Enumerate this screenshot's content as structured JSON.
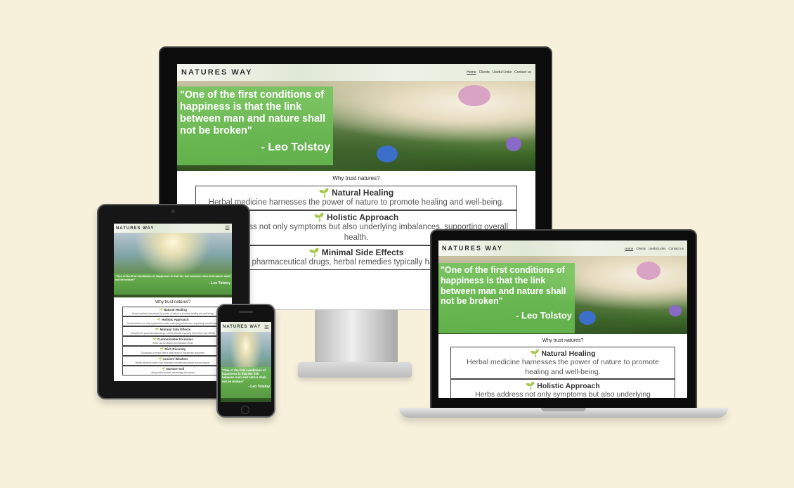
{
  "site": {
    "logo": "NATURES WAY",
    "nav": [
      "Home",
      "Clients",
      "Useful Links",
      "Contact us"
    ]
  },
  "hero": {
    "quote": "\"One of the first conditions of happiness is that the link between man and nature shall not be broken\"",
    "author": "- Leo Tolstoy"
  },
  "why": "Why trust natures?",
  "features": [
    {
      "title": "Natural Healing",
      "text": "Herbal medicine harnesses the power of nature to promote healing and well-being."
    },
    {
      "title": "Holistic Approach",
      "text": "Herbs address not only symptoms but also underlying imbalances, supporting overall health."
    },
    {
      "title": "Minimal Side Effects",
      "text": "Compared to pharmaceutical drugs, herbal remedies typically have fewer side effects."
    },
    {
      "title": "Customizable Formulas",
      "text": "Herbs can be tailored to individual needs."
    },
    {
      "title": "Rich Diversity",
      "text": "Thousands of herbal offer a wide range of therapeutic properties."
    },
    {
      "title": "Ancient Wisdom",
      "text": "Herbal medicine stems from centuries of traditional practice across cultures."
    },
    {
      "title": "Nurture Soil",
      "text": "Using herbs involves connecting with nature."
    }
  ],
  "colors": {
    "background": "#f7f1dc",
    "quote_box": "#6cc456",
    "bezel": "#111111"
  }
}
